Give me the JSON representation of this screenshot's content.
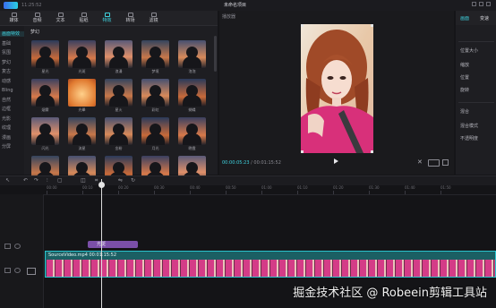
{
  "window": {
    "title_meta": "11:25:52",
    "project_title": "未命名项目"
  },
  "media": {
    "top_tabs": [
      {
        "label": "媒体",
        "icon": "media-icon",
        "active": false
      },
      {
        "label": "音频",
        "icon": "audio-icon",
        "active": false
      },
      {
        "label": "文本",
        "icon": "text-icon",
        "active": false
      },
      {
        "label": "贴纸",
        "icon": "sticker-icon",
        "active": false
      },
      {
        "label": "特效",
        "icon": "effects-icon",
        "active": true
      },
      {
        "label": "转场",
        "icon": "transition-icon",
        "active": false
      },
      {
        "label": "滤镜",
        "icon": "filter-icon",
        "active": false
      }
    ],
    "categories": [
      {
        "label": "画面特效",
        "active": true
      },
      {
        "label": "基础",
        "active": false
      },
      {
        "label": "氛围",
        "active": false
      },
      {
        "label": "梦幻",
        "active": false
      },
      {
        "label": "复古",
        "active": false
      },
      {
        "label": "动感",
        "active": false
      },
      {
        "label": "Bling",
        "active": false
      },
      {
        "label": "自然",
        "active": false
      },
      {
        "label": "边框",
        "active": false
      },
      {
        "label": "光影",
        "active": false
      },
      {
        "label": "纹理",
        "active": false
      },
      {
        "label": "漫画",
        "active": false
      },
      {
        "label": "分屏",
        "active": false
      }
    ],
    "section_heading": "梦幻",
    "effects": [
      {
        "label": "星光"
      },
      {
        "label": "光斑"
      },
      {
        "label": "浪漫"
      },
      {
        "label": "梦境"
      },
      {
        "label": "泡泡"
      },
      {
        "label": "烟雾"
      },
      {
        "label": "光晕"
      },
      {
        "label": "星火"
      },
      {
        "label": "彩虹"
      },
      {
        "label": "蝴蝶"
      },
      {
        "label": "闪光"
      },
      {
        "label": "流星"
      },
      {
        "label": "金粉"
      },
      {
        "label": "月光"
      },
      {
        "label": "晚霞"
      },
      {
        "label": ""
      },
      {
        "label": ""
      },
      {
        "label": ""
      },
      {
        "label": ""
      },
      {
        "label": ""
      }
    ]
  },
  "player": {
    "title": "播放器",
    "current_time": "00:00:05:23",
    "total_time": "00:01:15:52",
    "ratio_label": "比例"
  },
  "inspector": {
    "tabs": [
      {
        "label": "画面",
        "active": true
      },
      {
        "label": "变速",
        "active": false
      }
    ],
    "rows": [
      "位置大小",
      "缩放",
      "位置",
      "旋转",
      "混合",
      "混合模式",
      "不透明度"
    ]
  },
  "toolbar": {
    "tools": [
      "cursor-icon",
      "undo-icon",
      "redo-icon",
      "split-icon",
      "delete-icon",
      "freeze-icon",
      "crop-icon",
      "mirror-icon",
      "rotate-icon"
    ]
  },
  "timeline": {
    "ruler_ticks": [
      "00:00",
      "00:10",
      "00:20",
      "00:30",
      "00:40",
      "00:50",
      "01:00",
      "01:10",
      "01:20",
      "01:30",
      "01:40",
      "01:50"
    ],
    "effect_clip_label": "光斑",
    "video_clip_label": "SourceVideo.mp4 00:01:15:52"
  },
  "watermark": "掘金技术社区 @ Robeein剪辑工具站",
  "colors": {
    "accent": "#3fd4e0",
    "effect_clip": "#7b4fa8",
    "video_clip": "#1b5f63"
  }
}
